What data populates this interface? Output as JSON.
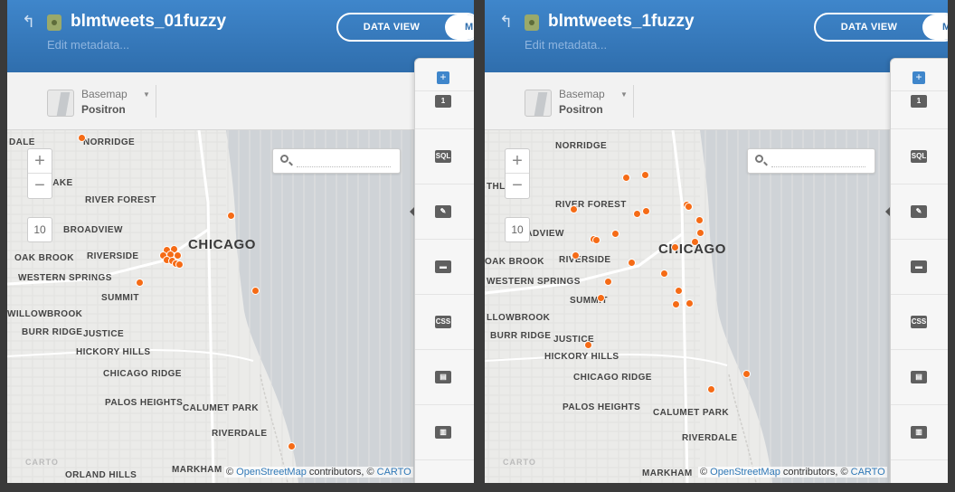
{
  "windows": [
    {
      "dataset_title": "blmtweets_01fuzzy",
      "edit_metadata": "Edit metadata...",
      "toggle": {
        "data_view": "DATA VIEW",
        "map_view": "M"
      },
      "basemap": {
        "label": "Basemap",
        "value": "Positron"
      },
      "zoom": {
        "in": "+",
        "out": "−",
        "level": "10"
      },
      "search": {
        "placeholder": ""
      },
      "labels": [
        {
          "text": "DALE",
          "cls": ""
        },
        {
          "text": "NORRIDGE",
          "cls": ""
        },
        {
          "text": "RTHLAKE",
          "cls": ""
        },
        {
          "text": "RIVER FOREST",
          "cls": ""
        },
        {
          "text": "BROADVIEW",
          "cls": ""
        },
        {
          "text": "CHICAGO",
          "cls": "city"
        },
        {
          "text": "OAK BROOK",
          "cls": ""
        },
        {
          "text": "RIVERSIDE",
          "cls": ""
        },
        {
          "text": "WESTERN SPRINGS",
          "cls": ""
        },
        {
          "text": "SUMMIT",
          "cls": ""
        },
        {
          "text": "WILLOWBROOK",
          "cls": ""
        },
        {
          "text": "JUSTICE",
          "cls": ""
        },
        {
          "text": "BURR RIDGE",
          "cls": ""
        },
        {
          "text": "HICKORY HILLS",
          "cls": ""
        },
        {
          "text": "CHICAGO RIDGE",
          "cls": ""
        },
        {
          "text": "PALOS HEIGHTS",
          "cls": ""
        },
        {
          "text": "CALUMET PARK",
          "cls": ""
        },
        {
          "text": "RIVERDALE",
          "cls": ""
        },
        {
          "text": "MARKHAM",
          "cls": ""
        },
        {
          "text": "ORLAND HILLS",
          "cls": ""
        }
      ],
      "attribution": {
        "prefix": "© ",
        "osm": "OpenStreetMap",
        "middle": " contributors, © ",
        "carto": "CARTO"
      },
      "carto_mark": "CARTO"
    },
    {
      "dataset_title": "blmtweets_1fuzzy",
      "edit_metadata": "Edit metadata...",
      "toggle": {
        "data_view": "DATA VIEW",
        "map_view": "M"
      },
      "basemap": {
        "label": "Basemap",
        "value": "Positron"
      },
      "zoom": {
        "in": "+",
        "out": "−",
        "level": "10"
      },
      "search": {
        "placeholder": ""
      },
      "labels": [
        {
          "text": "NORRIDGE",
          "cls": ""
        },
        {
          "text": "THLAKE",
          "cls": ""
        },
        {
          "text": "RIVER FOREST",
          "cls": ""
        },
        {
          "text": "BROADVIEW",
          "cls": ""
        },
        {
          "text": "CHICAGO",
          "cls": "city"
        },
        {
          "text": "OAK BROOK",
          "cls": ""
        },
        {
          "text": "RIVERSIDE",
          "cls": ""
        },
        {
          "text": "WESTERN SPRINGS",
          "cls": ""
        },
        {
          "text": "SUMMIT",
          "cls": ""
        },
        {
          "text": "LLOWBROOK",
          "cls": ""
        },
        {
          "text": "BURR RIDGE",
          "cls": ""
        },
        {
          "text": "JUSTICE",
          "cls": ""
        },
        {
          "text": "HICKORY HILLS",
          "cls": ""
        },
        {
          "text": "CHICAGO RIDGE",
          "cls": ""
        },
        {
          "text": "PALOS HEIGHTS",
          "cls": ""
        },
        {
          "text": "CALUMET PARK",
          "cls": ""
        },
        {
          "text": "RIVERDALE",
          "cls": ""
        },
        {
          "text": "MARKHAM",
          "cls": ""
        }
      ],
      "attribution": {
        "prefix": "© ",
        "osm": "OpenStreetMap",
        "middle": " contributors, © ",
        "carto": "CARTO"
      },
      "carto_mark": "CARTO"
    }
  ],
  "tools": [
    {
      "name": "add-layer-button",
      "glyph": "+",
      "kind": "add"
    },
    {
      "name": "layer-one-button",
      "glyph": "1",
      "kind": "icon"
    },
    {
      "name": "sql-tool-button",
      "glyph": "SQL",
      "kind": "icon"
    },
    {
      "name": "wizard-tool-button",
      "glyph": "✎",
      "kind": "icon"
    },
    {
      "name": "infowindow-tool-button",
      "glyph": "▬",
      "kind": "icon"
    },
    {
      "name": "css-tool-button",
      "glyph": "CSS",
      "kind": "icon"
    },
    {
      "name": "legend-tool-button",
      "glyph": "▤",
      "kind": "icon"
    },
    {
      "name": "filters-tool-button",
      "glyph": "▥",
      "kind": "icon"
    }
  ],
  "colors": {
    "header": "#2f6ead",
    "accent": "#f56b16",
    "lake": "#cfd3d7"
  }
}
